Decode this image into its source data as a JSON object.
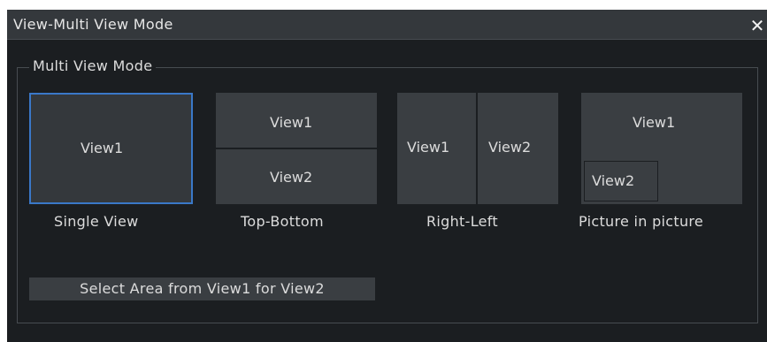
{
  "window": {
    "title": "View-Multi View Mode",
    "close_icon": "close-icon",
    "close_glyph": "✕"
  },
  "group": {
    "label": "Multi View Mode"
  },
  "modes": {
    "single": {
      "label": "Single View",
      "view1": "View1",
      "selected": true
    },
    "top_bottom": {
      "label": "Top-Bottom",
      "view1": "View1",
      "view2": "View2"
    },
    "right_left": {
      "label": "Right-Left",
      "view1": "View1",
      "view2": "View2"
    },
    "pip": {
      "label": "Picture in picture",
      "view1": "View1",
      "view2": "View2"
    }
  },
  "action_button": {
    "label": "Select Area from View1 for View2"
  },
  "colors": {
    "background": "#1b1e21",
    "tile": "#3a3e42",
    "selection": "#3a78c8",
    "text": "#dcdcdc"
  }
}
